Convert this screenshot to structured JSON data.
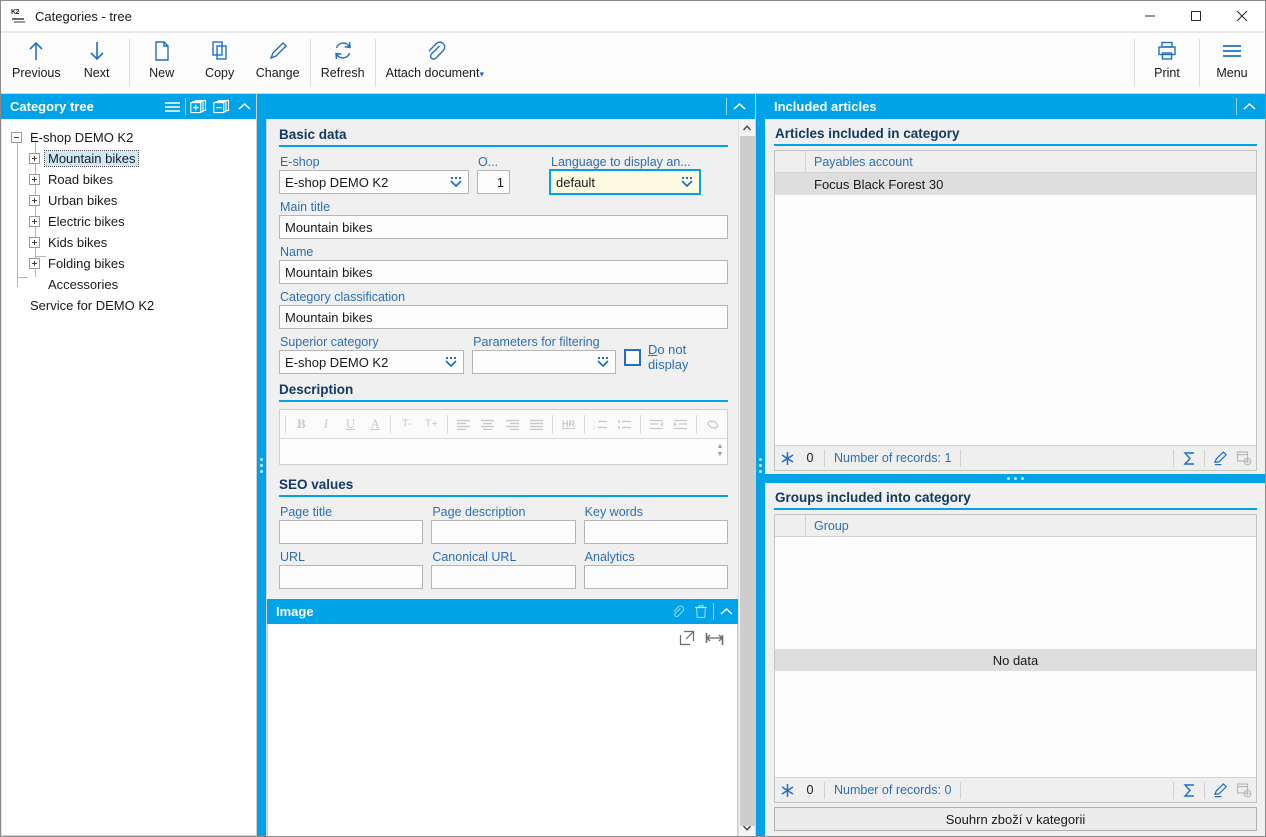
{
  "window": {
    "title": "Categories - tree",
    "app_icon": "k2-app-icon",
    "minimize_label": "Minimize",
    "maximize_label": "Maximize",
    "close_label": "Close"
  },
  "toolbar": {
    "buttons": [
      {
        "label": "Previous",
        "icon": "arrow-up-icon"
      },
      {
        "label": "Next",
        "icon": "arrow-down-icon"
      },
      {
        "label": "New",
        "icon": "document-icon"
      },
      {
        "label": "Copy",
        "icon": "copy-icon"
      },
      {
        "label": "Change",
        "icon": "pencil-icon"
      },
      {
        "label": "Refresh",
        "icon": "refresh-icon"
      },
      {
        "label": "Attach document",
        "icon": "paperclip-icon"
      }
    ],
    "right_buttons": [
      {
        "label": "Print",
        "icon": "printer-icon"
      },
      {
        "label": "Menu",
        "icon": "hamburger-icon"
      }
    ]
  },
  "tree_panel": {
    "title": "Category tree",
    "header_icons": [
      "menu-icon",
      "expand-all-icon",
      "collapse-all-icon",
      "chevron-up-icon"
    ],
    "nodes": [
      {
        "label": "E-shop DEMO K2",
        "level": 0,
        "state": "expanded",
        "selected": false
      },
      {
        "label": "Mountain bikes",
        "level": 1,
        "state": "collapsed",
        "selected": true
      },
      {
        "label": "Road bikes",
        "level": 1,
        "state": "collapsed",
        "selected": false
      },
      {
        "label": "Urban bikes",
        "level": 1,
        "state": "collapsed",
        "selected": false
      },
      {
        "label": "Electric bikes",
        "level": 1,
        "state": "collapsed",
        "selected": false
      },
      {
        "label": "Kids bikes",
        "level": 1,
        "state": "collapsed",
        "selected": false
      },
      {
        "label": "Folding bikes",
        "level": 1,
        "state": "collapsed",
        "selected": false
      },
      {
        "label": "Accessories",
        "level": 1,
        "state": "leaf",
        "selected": false
      },
      {
        "label": "Service for DEMO K2",
        "level": 0,
        "state": "leaf",
        "selected": false
      }
    ]
  },
  "form": {
    "basic_data": {
      "title": "Basic data",
      "eshop_label": "E-shop",
      "eshop_value": "E-shop DEMO K2",
      "order_label": "O...",
      "order_value": "1",
      "language_label": "Language to display an...",
      "language_value": "default",
      "main_title_label": "Main title",
      "main_title_value": "Mountain bikes",
      "name_label": "Name",
      "name_value": "Mountain bikes",
      "classification_label": "Category classification",
      "classification_value": "Mountain bikes",
      "superior_label": "Superior category",
      "superior_value": "E-shop DEMO K2",
      "parameters_label": "Parameters for filtering",
      "parameters_value": "",
      "do_not_display_label": "Do not display",
      "do_not_display_checked": false
    },
    "description": {
      "title": "Description",
      "value": "",
      "toolbar_buttons": [
        "bold-icon",
        "italic-icon",
        "underline-icon",
        "font-color-icon",
        "font-shrink-icon",
        "font-grow-icon",
        "align-left-icon",
        "align-center-icon",
        "align-right-icon",
        "align-justify-icon",
        "horizontal-rule-icon",
        "numbered-list-icon",
        "bulleted-list-icon",
        "outdent-icon",
        "indent-icon",
        "link-icon"
      ]
    },
    "seo": {
      "title": "SEO values",
      "fields": [
        {
          "label": "Page title",
          "value": ""
        },
        {
          "label": "Page description",
          "value": ""
        },
        {
          "label": "Key words",
          "value": ""
        },
        {
          "label": "URL",
          "value": ""
        },
        {
          "label": "Canonical URL",
          "value": ""
        },
        {
          "label": "Analytics",
          "value": ""
        }
      ]
    },
    "image": {
      "title": "Image",
      "header_icons": [
        "paperclip-icon",
        "trash-icon",
        "chevron-up-icon"
      ],
      "body_icons": [
        "open-external-icon",
        "fit-width-icon"
      ]
    }
  },
  "right_panel": {
    "title": "Included articles",
    "header_icons": [
      "chevron-up-icon"
    ],
    "articles": {
      "title": "Articles included in category",
      "columns": [
        "Payables account"
      ],
      "rows": [
        {
          "cells": [
            "Focus Black Forest 30"
          ],
          "selected": true
        }
      ],
      "footer": {
        "star_icon": "asterisk-filter-icon",
        "count": "0",
        "records": "Number of records: 1",
        "icons": [
          "sum-icon",
          "edit-icon",
          "duplicate-add-icon"
        ]
      }
    },
    "groups": {
      "title": "Groups included into category",
      "columns": [
        "Group"
      ],
      "rows": [],
      "empty_text": "No data",
      "footer": {
        "star_icon": "asterisk-filter-icon",
        "count": "0",
        "records": "Number of records: 0",
        "icons": [
          "sum-icon",
          "edit-icon",
          "duplicate-add-icon"
        ]
      }
    },
    "summary_button": "Souhrn zboží v kategorii"
  },
  "colors": {
    "accent": "#00a2e8",
    "icon_blue": "#1f6fc4",
    "label_blue": "#2d6fb5",
    "heading_blue": "#123a63",
    "selection": "#cde8f7",
    "row_selected": "#dedede",
    "active_field": "#fdfce3"
  }
}
